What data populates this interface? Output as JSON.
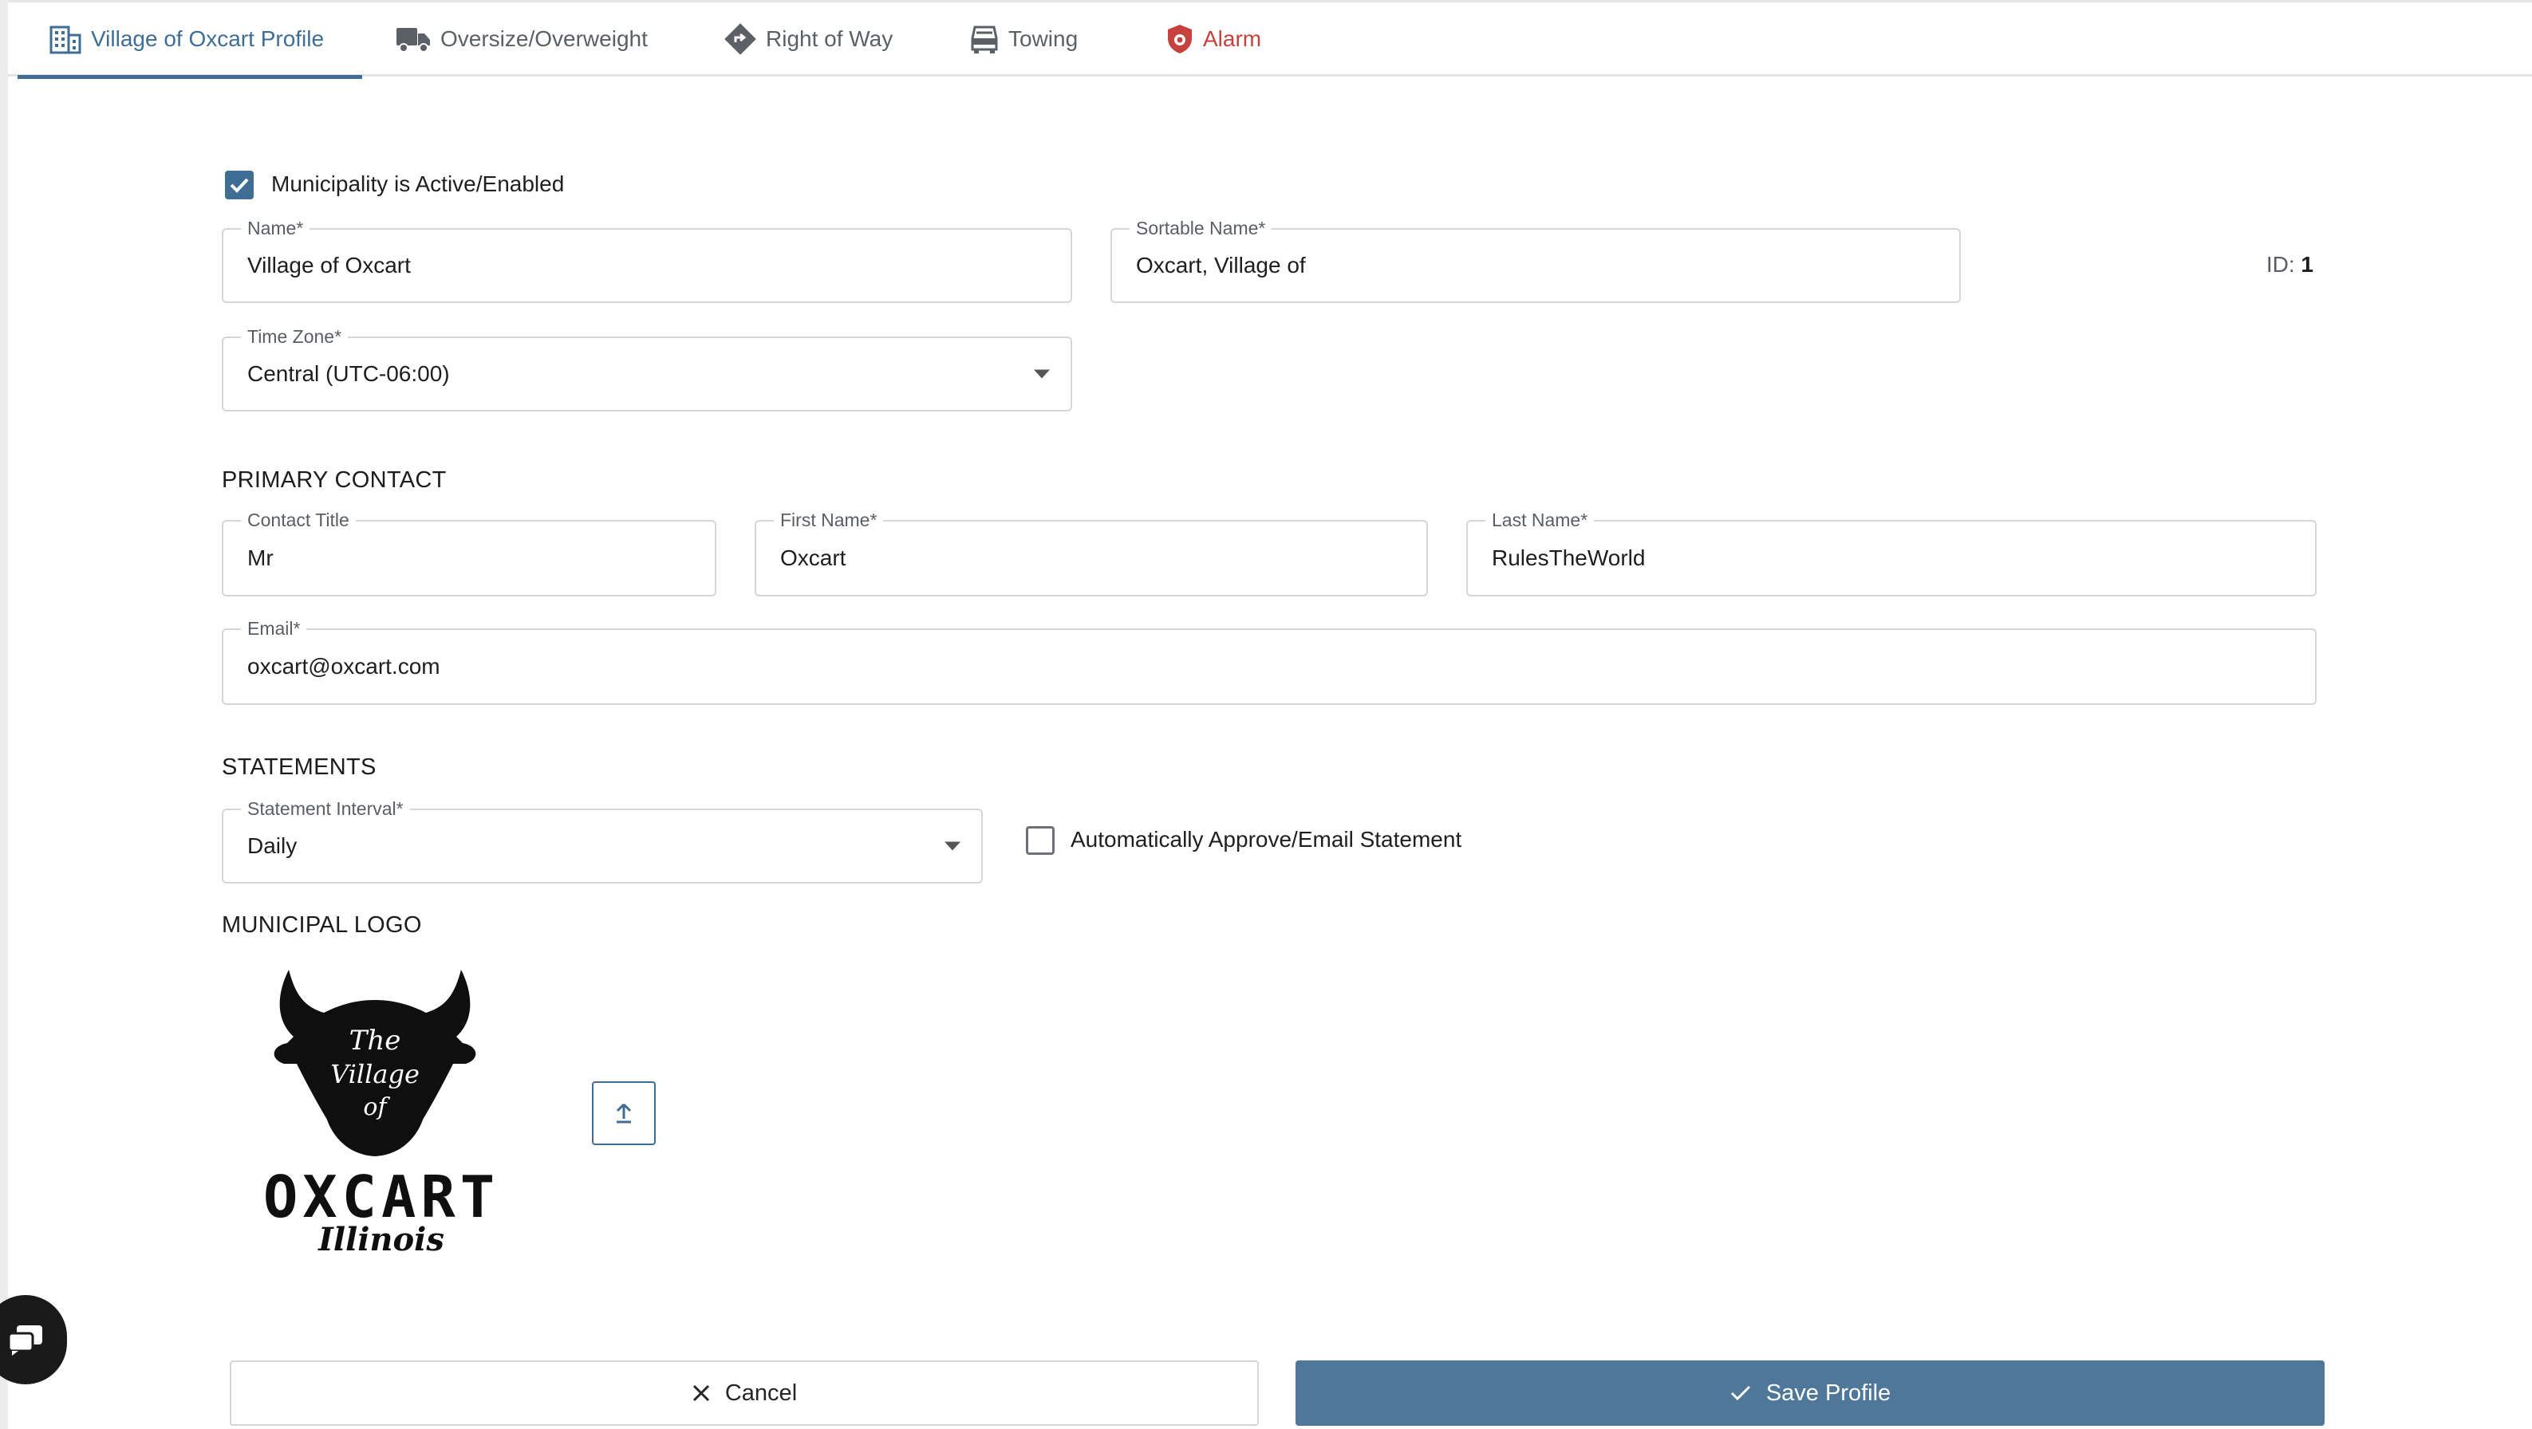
{
  "tabs": [
    {
      "label": "Village of Oxcart Profile",
      "icon": "building-icon",
      "active": true
    },
    {
      "label": "Oversize/Overweight",
      "icon": "truck-icon",
      "active": false
    },
    {
      "label": "Right of Way",
      "icon": "direction-sign-icon",
      "active": false
    },
    {
      "label": "Towing",
      "icon": "car-icon",
      "active": false
    },
    {
      "label": "Alarm",
      "icon": "shield-alarm-icon",
      "active": false
    }
  ],
  "profile": {
    "active_checkbox_label": "Municipality is Active/Enabled",
    "active_checked": true,
    "name": {
      "label": "Name*",
      "value": "Village of Oxcart"
    },
    "sortable_name": {
      "label": "Sortable Name*",
      "value": "Oxcart, Village of"
    },
    "id_label": "ID:",
    "id_value": "1",
    "time_zone": {
      "label": "Time Zone*",
      "value": "Central (UTC-06:00)"
    }
  },
  "primary_contact": {
    "heading": "PRIMARY CONTACT",
    "contact_title": {
      "label": "Contact Title",
      "value": "Mr"
    },
    "first_name": {
      "label": "First Name*",
      "value": "Oxcart"
    },
    "last_name": {
      "label": "Last Name*",
      "value": "RulesTheWorld"
    },
    "email": {
      "label": "Email*",
      "value": "oxcart@oxcart.com"
    }
  },
  "statements": {
    "heading": "STATEMENTS",
    "interval": {
      "label": "Statement Interval*",
      "value": "Daily"
    },
    "auto_approve_label": "Automatically Approve/Email Statement",
    "auto_approve_checked": false
  },
  "logo": {
    "heading": "MUNICIPAL LOGO",
    "text_the": "The",
    "text_village": "Village",
    "text_of": "of",
    "text_main": "OXCART",
    "text_state": "Illinois"
  },
  "actions": {
    "cancel_label": "Cancel",
    "save_label": "Save Profile"
  },
  "colors": {
    "accent": "#3e6d95",
    "alarm": "#c7423d",
    "save_button": "#4e7799"
  }
}
